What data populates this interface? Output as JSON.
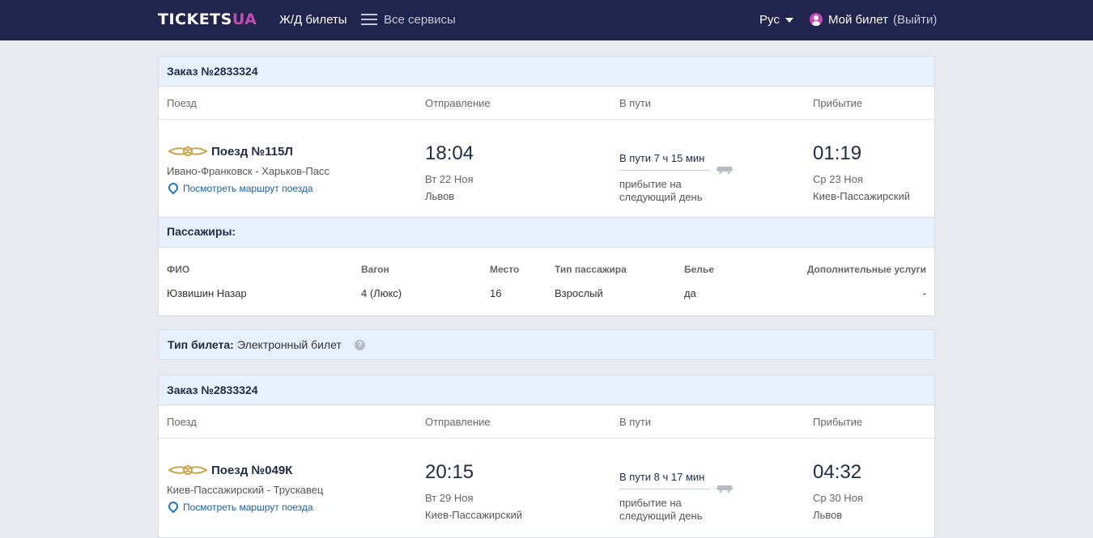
{
  "header": {
    "logo_main": "TICKETS",
    "logo_accent": "UA",
    "nav_rail": "Ж/Д билеты",
    "nav_all": "Все сервисы",
    "lang": "Рус",
    "my_ticket": "Мой билет",
    "logout": "(Выйти)"
  },
  "columns": {
    "train": "Поезд",
    "departure": "Отправление",
    "in_transit": "В пути",
    "arrival": "Прибытие"
  },
  "route_link": "Посмотреть маршрут поезда",
  "next_day": "прибытие на следующий день",
  "orders": [
    {
      "title": "Заказ №2833324",
      "train": "Поезд №115Л",
      "route": "Ивано-Франковск - Харьков-Пасс",
      "dep_time": "18:04",
      "dep_date": "Вт 22 Ноя",
      "dep_station": "Львов",
      "duration": "В пути 7 ч 15 мин",
      "arr_time": "01:19",
      "arr_date": "Ср 23 Ноя",
      "arr_station": "Киев-Пассажирский"
    },
    {
      "title": "Заказ №2833324",
      "train": "Поезд №049К",
      "route": "Киев-Пассажирский - Трускавец",
      "dep_time": "20:15",
      "dep_date": "Вт 29 Ноя",
      "dep_station": "Киев-Пассажирский",
      "duration": "В пути 8 ч 17 мин",
      "arr_time": "04:32",
      "arr_date": "Ср 30 Ноя",
      "arr_station": "Львов"
    }
  ],
  "passengers": {
    "title": "Пассажиры:",
    "headers": {
      "name": "ФИО",
      "car": "Вагон",
      "seat": "Место",
      "type": "Тип пассажира",
      "linen": "Белье",
      "extra": "Дополнительные услуги"
    },
    "rows": [
      {
        "name": "Юзвишин Назар",
        "car": "4 (Люкс)",
        "seat": "16",
        "type": "Взрослый",
        "linen": "да",
        "extra": "-"
      }
    ]
  },
  "ticket_type": {
    "label": "Тип билета:",
    "value": "Электронный билет",
    "help": "?"
  },
  "colors": {
    "header_bg": "#21244d",
    "accent": "#c44ab5",
    "link": "#1a5fa8",
    "section_bg": "#e7f0fd"
  }
}
